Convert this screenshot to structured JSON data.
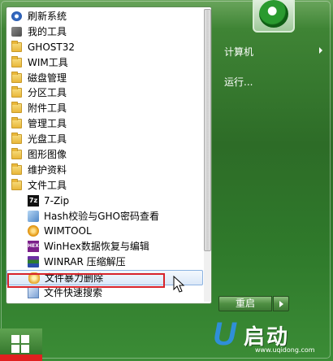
{
  "start_menu": {
    "programs": [
      {
        "label": "刷新系统",
        "icon": "refresh-icon",
        "type": "app",
        "level": 0
      },
      {
        "label": "我的工具",
        "icon": "tools-icon",
        "type": "app",
        "level": 0
      },
      {
        "label": "GHOST32",
        "icon": "folder-icon",
        "type": "folder",
        "level": 0
      },
      {
        "label": "WIM工具",
        "icon": "folder-icon",
        "type": "folder",
        "level": 0
      },
      {
        "label": "磁盘管理",
        "icon": "folder-icon",
        "type": "folder",
        "level": 0
      },
      {
        "label": "分区工具",
        "icon": "folder-icon",
        "type": "folder",
        "level": 0
      },
      {
        "label": "附件工具",
        "icon": "folder-icon",
        "type": "folder",
        "level": 0
      },
      {
        "label": "管理工具",
        "icon": "folder-icon",
        "type": "folder",
        "level": 0
      },
      {
        "label": "光盘工具",
        "icon": "folder-icon",
        "type": "folder",
        "level": 0
      },
      {
        "label": "图形图像",
        "icon": "folder-icon",
        "type": "folder",
        "level": 0
      },
      {
        "label": "维护资料",
        "icon": "folder-icon",
        "type": "folder",
        "level": 0
      },
      {
        "label": "文件工具",
        "icon": "folder-icon",
        "type": "folder",
        "level": 0
      },
      {
        "label": "7-Zip",
        "icon": "7zip-icon",
        "type": "app",
        "level": 1
      },
      {
        "label": "Hash校验与GHO密码查看",
        "icon": "hash-icon",
        "type": "app",
        "level": 1
      },
      {
        "label": "WIMTOOL",
        "icon": "wimtool-icon",
        "type": "app",
        "level": 1
      },
      {
        "label": "WinHex数据恢复与编辑",
        "icon": "winhex-icon",
        "type": "app",
        "level": 1
      },
      {
        "label": "WINRAR 压缩解压",
        "icon": "winrar-icon",
        "type": "app",
        "level": 1
      },
      {
        "label": "文件暴力删除",
        "icon": "force-delete-icon",
        "type": "app",
        "level": 1,
        "selected": true
      },
      {
        "label": "文件快速搜索",
        "icon": "file-search-icon",
        "type": "app",
        "level": 1
      }
    ],
    "icon_text": {
      "7zip": "7z",
      "winhex": "HEX"
    },
    "right_pane": {
      "computer_label": "计算机",
      "run_label": "运行..."
    },
    "shutdown": {
      "restart_label": "重启"
    }
  },
  "brand": {
    "name": "启动",
    "url": "www.uqidong.com"
  },
  "colors": {
    "highlight_border": "#d8232a",
    "selection_border": "#8cb3e1",
    "aero_green": "#2f6e2a"
  }
}
